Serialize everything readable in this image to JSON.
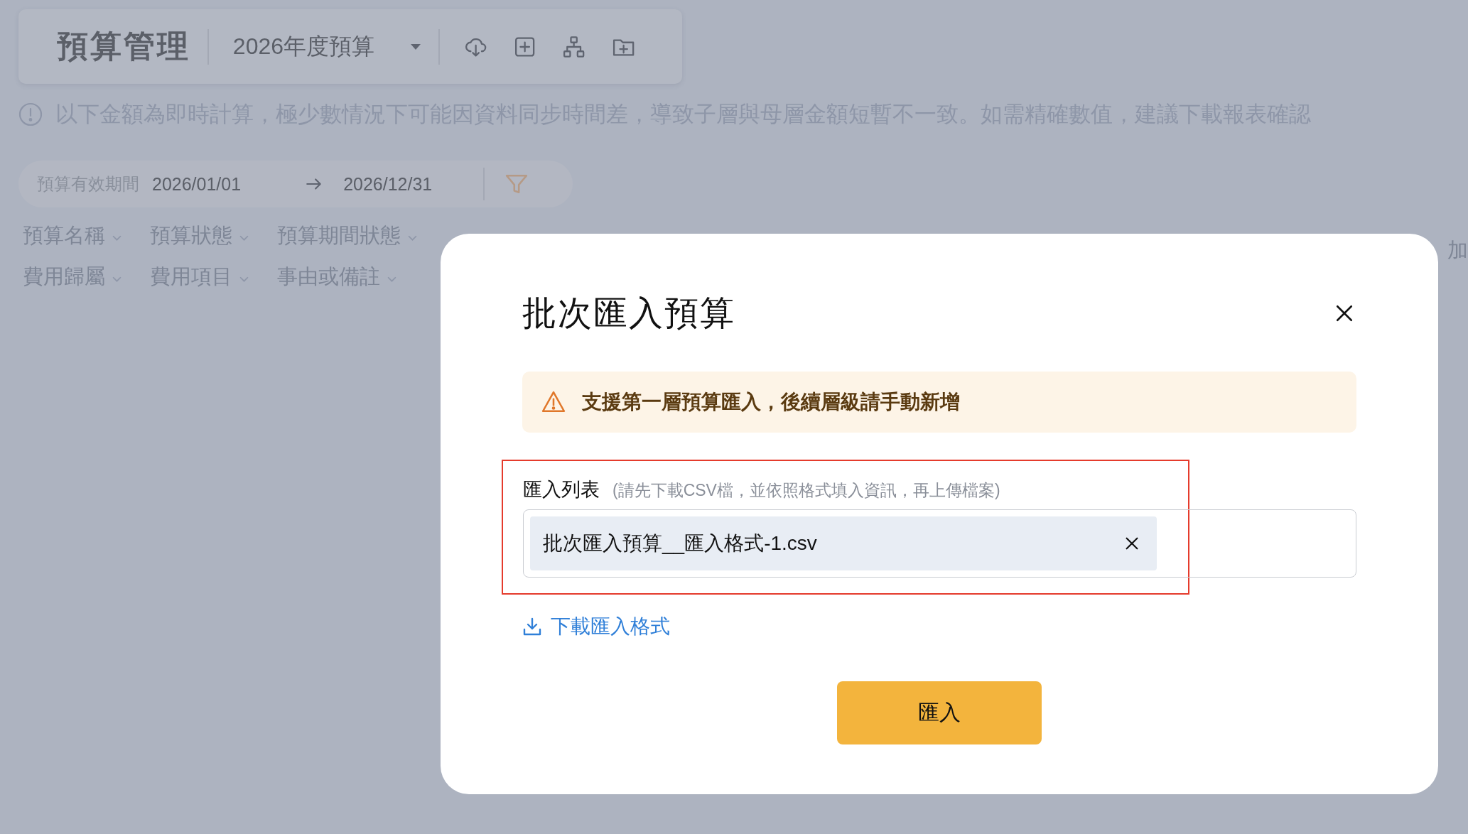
{
  "header": {
    "title": "預算管理",
    "budget_select": "2026年度預算",
    "toolbar": [
      {
        "kind": "cloud-download"
      },
      {
        "kind": "add"
      },
      {
        "kind": "hierarchy"
      },
      {
        "kind": "folder-add"
      }
    ]
  },
  "notice": "以下金額為即時計算，極少數情況下可能因資料同步時間差，導致子層與母層金額短暫不一致。如需精確數值，建議下載報表確認",
  "date_range": {
    "label": "預算有效期間",
    "start": "2026/01/01",
    "end": "2026/12/31"
  },
  "filters": [
    [
      "預算名稱",
      "預算狀態",
      "預算期間狀態"
    ],
    [
      "費用歸屬",
      "費用項目",
      "事由或備註"
    ]
  ],
  "edge_text": "加",
  "modal": {
    "title": "批次匯入預算",
    "alert": "支援第一層預算匯入，後續層級請手動新增",
    "import_list": {
      "label": "匯入列表",
      "hint": "(請先下載CSV檔，並依照格式填入資訊，再上傳檔案)",
      "highlighted": true,
      "files": [
        "批次匯入預算__匯入格式-1.csv"
      ]
    },
    "download_link": "下載匯入格式",
    "submit": "匯入"
  }
}
